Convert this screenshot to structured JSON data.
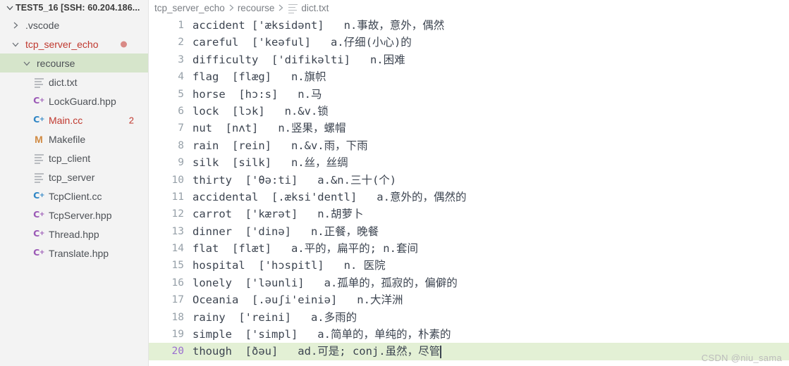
{
  "sidebar": {
    "title": "TEST5_16 [SSH: 60.204.186...",
    "title_chevron": "chevron-down-icon",
    "items": [
      {
        "label": ".vscode",
        "indent": 14,
        "chevron": "chevron-right-icon",
        "icon": "none",
        "icon_color": "",
        "text_color": "#4d5156",
        "selected": false,
        "badge_dot": "",
        "badge_num": ""
      },
      {
        "label": "tcp_server_echo",
        "indent": 14,
        "chevron": "chevron-down-icon",
        "icon": "none",
        "icon_color": "",
        "text_color": "#c0392f",
        "selected": false,
        "badge_dot": "#d98a86",
        "badge_num": ""
      },
      {
        "label": "recourse",
        "indent": 30,
        "chevron": "chevron-down-icon",
        "icon": "none",
        "icon_color": "",
        "text_color": "#4d5156",
        "selected": true,
        "badge_dot": "",
        "badge_num": ""
      },
      {
        "label": "dict.txt",
        "indent": 46,
        "chevron": "none",
        "icon": "text-file-icon",
        "icon_color": "#b9bcc0",
        "text_color": "#4d5156",
        "selected": false,
        "badge_dot": "",
        "badge_num": ""
      },
      {
        "label": "LockGuard.hpp",
        "indent": 46,
        "chevron": "none",
        "icon": "cpp-file-icon",
        "icon_color": "#9b59b6",
        "text_color": "#4d5156",
        "selected": false,
        "badge_dot": "",
        "badge_num": ""
      },
      {
        "label": "Main.cc",
        "indent": 46,
        "chevron": "none",
        "icon": "cpp-file-icon",
        "icon_color": "#2f86c5",
        "text_color": "#c0392f",
        "selected": false,
        "badge_dot": "",
        "badge_num": "2"
      },
      {
        "label": "Makefile",
        "indent": 46,
        "chevron": "none",
        "icon": "makefile-icon",
        "icon_color": "#d08a42",
        "text_color": "#4d5156",
        "selected": false,
        "badge_dot": "",
        "badge_num": ""
      },
      {
        "label": "tcp_client",
        "indent": 46,
        "chevron": "none",
        "icon": "text-file-icon",
        "icon_color": "#b9bcc0",
        "text_color": "#4d5156",
        "selected": false,
        "badge_dot": "",
        "badge_num": ""
      },
      {
        "label": "tcp_server",
        "indent": 46,
        "chevron": "none",
        "icon": "text-file-icon",
        "icon_color": "#b9bcc0",
        "text_color": "#4d5156",
        "selected": false,
        "badge_dot": "",
        "badge_num": ""
      },
      {
        "label": "TcpClient.cc",
        "indent": 46,
        "chevron": "none",
        "icon": "cpp-file-icon",
        "icon_color": "#2f86c5",
        "text_color": "#4d5156",
        "selected": false,
        "badge_dot": "",
        "badge_num": ""
      },
      {
        "label": "TcpServer.hpp",
        "indent": 46,
        "chevron": "none",
        "icon": "cpp-file-icon",
        "icon_color": "#9b59b6",
        "text_color": "#4d5156",
        "selected": false,
        "badge_dot": "",
        "badge_num": ""
      },
      {
        "label": "Thread.hpp",
        "indent": 46,
        "chevron": "none",
        "icon": "cpp-file-icon",
        "icon_color": "#9b59b6",
        "text_color": "#4d5156",
        "selected": false,
        "badge_dot": "",
        "badge_num": ""
      },
      {
        "label": "Translate.hpp",
        "indent": 46,
        "chevron": "none",
        "icon": "cpp-file-icon",
        "icon_color": "#9b59b6",
        "text_color": "#4d5156",
        "selected": false,
        "badge_dot": "",
        "badge_num": ""
      }
    ]
  },
  "breadcrumb": {
    "segments": [
      "tcp_server_echo",
      "recourse",
      "dict.txt"
    ],
    "separator": "chevron-right-icon",
    "file_icon": "text-file-icon"
  },
  "editor": {
    "file_name": "dict.txt",
    "active_line": 20,
    "active_line_color": "#e3f0d5",
    "lines": [
      {
        "n": "1",
        "text": "accident ['æksidənt]   n.事故，意外，偶然"
      },
      {
        "n": "2",
        "text": "careful  ['keəful]   a.仔细(小心)的"
      },
      {
        "n": "3",
        "text": "difficulty  ['difikəlti]   n.困难"
      },
      {
        "n": "4",
        "text": "flag  [flæg]   n.旗帜"
      },
      {
        "n": "5",
        "text": "horse  [hɔ:s]   n.马"
      },
      {
        "n": "6",
        "text": "lock  [lɔk]   n.&v.锁"
      },
      {
        "n": "7",
        "text": "nut  [nʌt]   n.竖果，螺帽"
      },
      {
        "n": "8",
        "text": "rain  [rein]   n.&v.雨，下雨"
      },
      {
        "n": "9",
        "text": "silk  [silk]   n.丝，丝绸"
      },
      {
        "n": "10",
        "text": "thirty  ['θə:ti]   a.&n.三十(个)"
      },
      {
        "n": "11",
        "text": "accidental  [.æksi'dentl]   a.意外的，偶然的"
      },
      {
        "n": "12",
        "text": "carrot  ['kærət]   n.胡萝卜"
      },
      {
        "n": "13",
        "text": "dinner  ['dinə]   n.正餐，晚餐"
      },
      {
        "n": "14",
        "text": "flat  [flæt]   a.平的，扁平的; n.套间"
      },
      {
        "n": "15",
        "text": "hospital  ['hɔspitl]   n. 医院"
      },
      {
        "n": "16",
        "text": "lonely  ['ləunli]   a.孤单的，孤寂的，偏僻的"
      },
      {
        "n": "17",
        "text": "Oceania  [.əuʃi'einiə]   n.大洋洲"
      },
      {
        "n": "18",
        "text": "rainy  ['reini]   a.多雨的"
      },
      {
        "n": "19",
        "text": "simple  ['simpl]   a.简单的，单纯的，朴素的"
      },
      {
        "n": "20",
        "text": "though  [ðəu]   ad.可是; conj.虽然，尽管"
      }
    ]
  },
  "watermark": {
    "text": "CSDN @niu_sama"
  }
}
